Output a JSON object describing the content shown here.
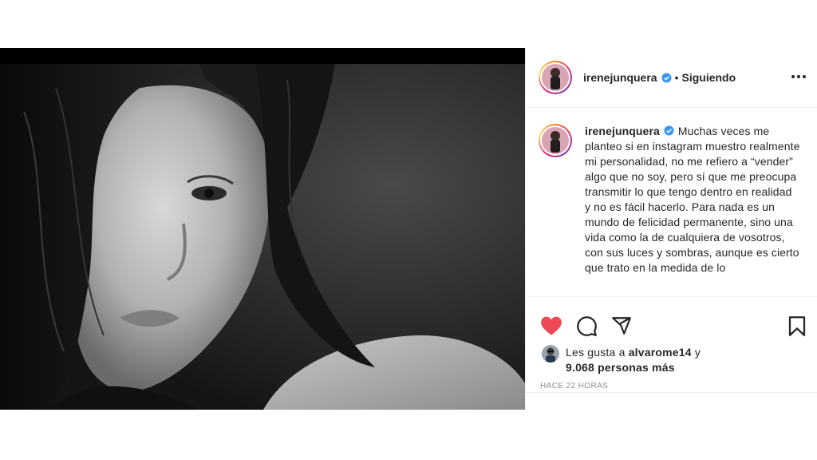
{
  "post": {
    "username": "irenejunquera",
    "separator": "•",
    "follow_status": "Siguiendo",
    "caption": "Muchas veces me planteo si en instagram muestro realmente mi personalidad, no me refiero a “vender” algo que no soy, pero sí que me preocupa transmitir lo que tengo dentro en realidad y no es fácil hacerlo. Para nada es un mundo de felicidad permanente, sino una vida como la de cualquiera de vosotros, con sus luces y sombras, aunque es cierto que trato en la medida de lo",
    "likes": {
      "prefix": "Les gusta a",
      "liker": "alvarome14",
      "conjunction": "y",
      "others": "9.068 personas más"
    },
    "timestamp": "HACE 22 HORAS"
  },
  "icons": {
    "like": "heart-filled-icon",
    "comment": "comment-icon",
    "share": "paper-plane-icon",
    "save": "bookmark-icon",
    "more": "more-options-icon",
    "verified": "verified-badge-icon"
  },
  "colors": {
    "like_red": "#ed4956",
    "verified_blue": "#3897f0",
    "text": "#262626",
    "muted": "#8e8e8e",
    "divider": "#efefef"
  }
}
